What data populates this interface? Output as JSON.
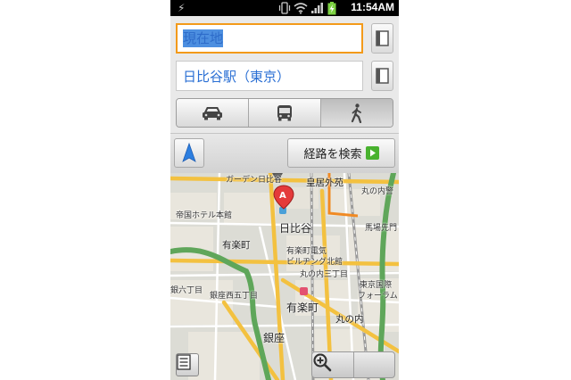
{
  "status_bar": {
    "time": "11:54AM",
    "icons": [
      "usb-icon",
      "vibrate-icon",
      "wifi-icon",
      "signal-icon",
      "battery-charging-icon"
    ]
  },
  "route": {
    "origin": {
      "value": "現在地",
      "selected": true
    },
    "destination": {
      "value": "日比谷駅（東京）"
    }
  },
  "travel_modes": [
    {
      "icon": "car-icon",
      "selected": false
    },
    {
      "icon": "bus-icon",
      "selected": false
    },
    {
      "icon": "walk-icon",
      "selected": true
    }
  ],
  "actions": {
    "search_label": "経路を検索"
  },
  "map": {
    "marker_label": "A",
    "labels": {
      "garden": "ガーデン日比谷",
      "kokyo": "皇居外苑",
      "marunouchi": "丸の内警",
      "teikoku": "帝国ホテル本館",
      "hibiya": "日比谷",
      "babasaki": "馬場先門",
      "yurakucho_chome": "有楽町",
      "yurakucho_bldg": "有楽町電気",
      "bldg_north": "ビルヂング北館",
      "marunouchi3": "丸の内三丁目",
      "tokyo_intl": "東京国際",
      "forum": "フォーラム",
      "ginza6": "銀六丁目",
      "ginza5": "銀座西五丁目",
      "yurakucho_st": "有楽町",
      "marunouchi_st": "丸の内",
      "ginza": "銀座"
    },
    "colors": {
      "highway": "#5fa65a",
      "major_road": "#f3c140",
      "minor_road": "#ffffff",
      "railway": "#9a9a9a",
      "block": "#e8e5dc"
    }
  }
}
